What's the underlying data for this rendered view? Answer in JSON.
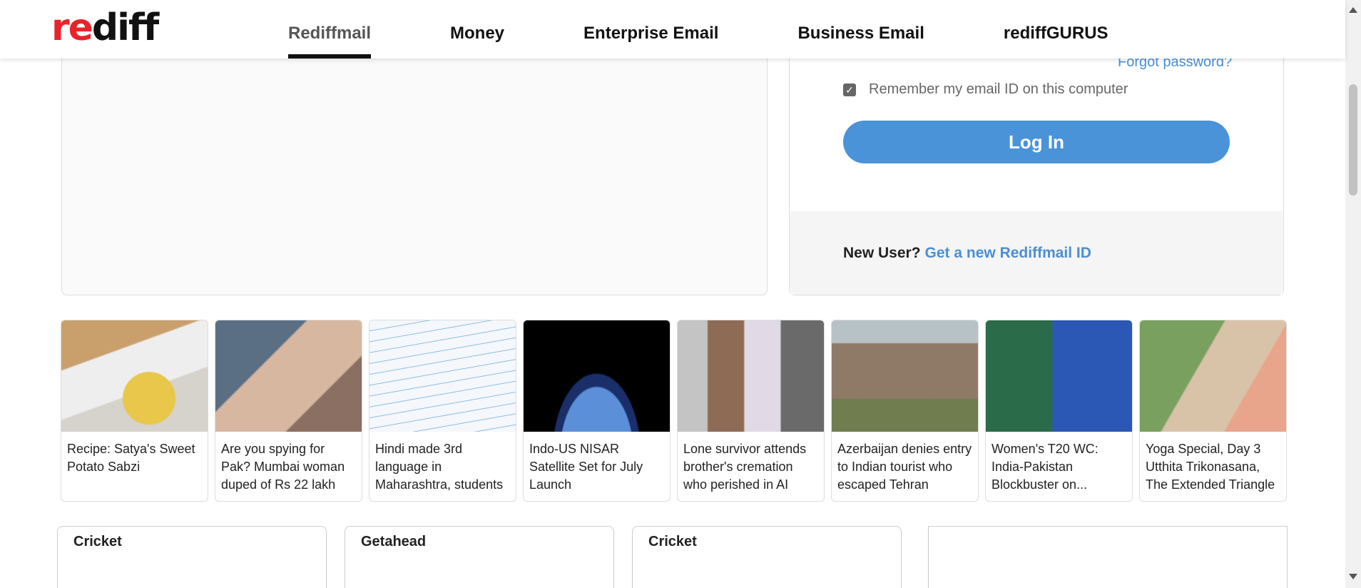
{
  "header": {
    "logo": {
      "re": "re",
      "diff": "diff"
    },
    "nav": [
      {
        "label": "Rediffmail",
        "active": true
      },
      {
        "label": "Money"
      },
      {
        "label": "Enterprise Email"
      },
      {
        "label": "Business Email"
      },
      {
        "label": "rediffGURUS"
      }
    ]
  },
  "login": {
    "forgot_password": "Forgot password?",
    "remember_label": "Remember my email ID on this computer",
    "remember_checked": true,
    "login_button": "Log In",
    "new_user_label": "New User?",
    "new_user_link": "Get a new Rediffmail ID"
  },
  "news": [
    {
      "caption": "Recipe: Satya's Sweet Potato Sabzi"
    },
    {
      "caption": "Are you spying for Pak? Mumbai woman duped of Rs 22 lakh"
    },
    {
      "caption": "Hindi made 3rd language in Maharashtra, students"
    },
    {
      "caption": "Indo-US NISAR Satellite Set for July Launch"
    },
    {
      "caption": "Lone survivor attends brother's cremation who perished in AI"
    },
    {
      "caption": "Azerbaijan denies entry to Indian tourist who escaped Tehran"
    },
    {
      "caption": "Women's T20 WC: India-Pakistan Blockbuster on..."
    },
    {
      "caption": "Yoga Special, Day 3 Utthita Trikonasana, The Extended Triangle"
    }
  ],
  "sections": [
    {
      "title": "Cricket"
    },
    {
      "title": "Getahead"
    },
    {
      "title": "Cricket"
    },
    {
      "title": ""
    }
  ],
  "colors": {
    "brand_red": "#e8232a",
    "link_blue": "#4a8fd3",
    "button_blue": "#4a93d8"
  }
}
